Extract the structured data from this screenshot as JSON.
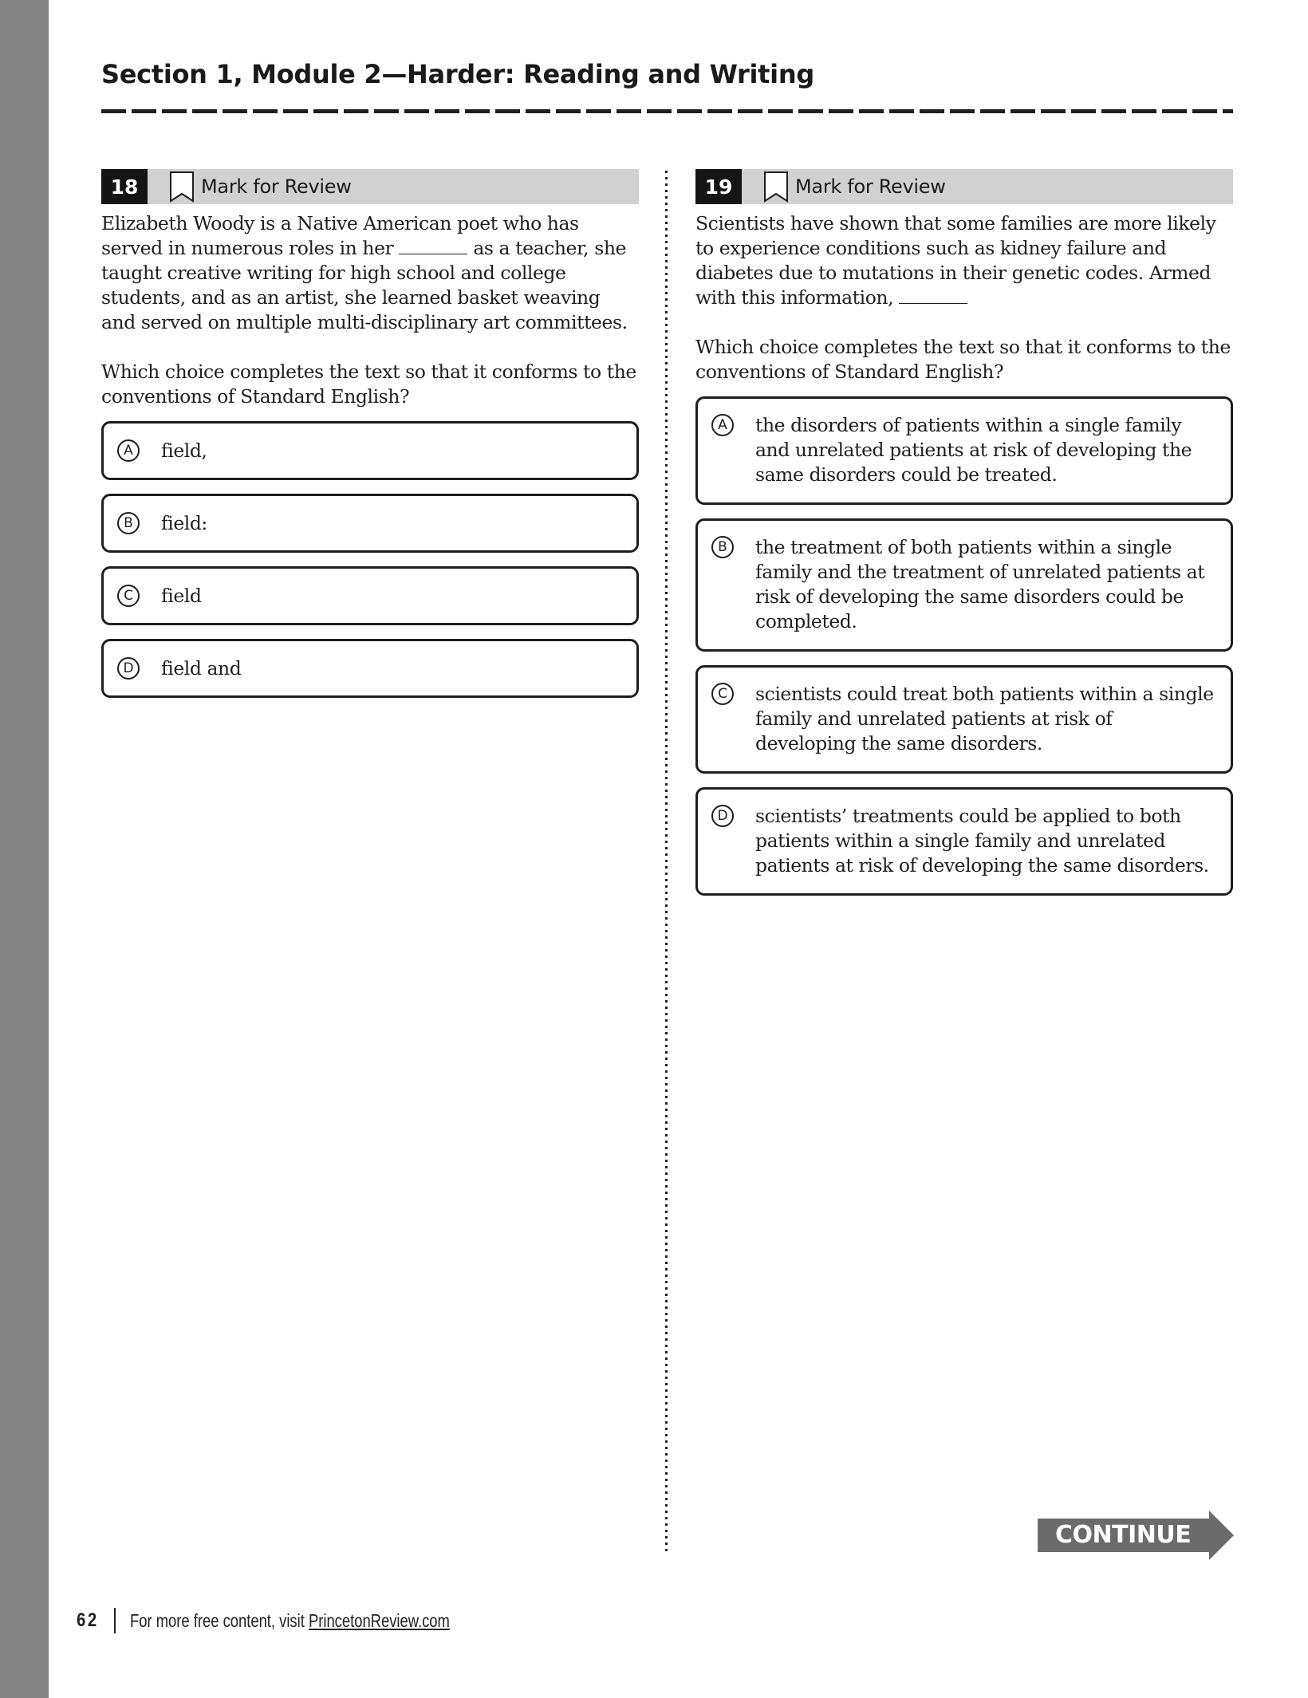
{
  "page": {
    "title": "Section 1, Module 2—Harder: Reading and Writing",
    "page_number": "62",
    "footer_text": "For more free content, visit ",
    "footer_link": "PrincetonReview.com",
    "continue_label": "CONTINUE"
  },
  "questions": [
    {
      "number": "18",
      "mark_label": "Mark for Review",
      "stem_before": "Elizabeth Woody is a Native American poet who has served in numerous roles in her ",
      "stem_after": " as a teacher, she taught creative writing for high school and college students, and as an artist, she learned basket weaving and served on multiple multi-disciplinary art committees.",
      "prompt": "Which choice completes the text so that it conforms to the conventions of Standard English?",
      "choices": [
        {
          "letter": "A",
          "text": "field,"
        },
        {
          "letter": "B",
          "text": "field:"
        },
        {
          "letter": "C",
          "text": "field"
        },
        {
          "letter": "D",
          "text": "field and"
        }
      ]
    },
    {
      "number": "19",
      "mark_label": "Mark for Review",
      "stem_before": "Scientists have shown that some families are more likely to experience conditions such as kidney failure and diabetes due to mutations in their genetic codes. Armed with this information, ",
      "stem_after": "",
      "prompt": "Which choice completes the text so that it conforms to the conventions of Standard English?",
      "choices": [
        {
          "letter": "A",
          "text": "the disorders of patients within a single family and unrelated patients at risk of developing the same disorders could be treated."
        },
        {
          "letter": "B",
          "text": "the treatment of both patients within a single family and the treatment of unrelated patients at risk of developing the same disorders could be completed."
        },
        {
          "letter": "C",
          "text": "scientists could treat both patients within a single family and unrelated patients at risk of developing the same disorders."
        },
        {
          "letter": "D",
          "text": "scientists’ treatments could be applied to both patients within a single family and unrelated patients at risk of developing the same disorders."
        }
      ]
    }
  ],
  "colors": {
    "sidebar": "#838383",
    "header_bar": "#d1d1d1",
    "number_badge": "#141414",
    "continue_button": "#6b6b6b"
  }
}
